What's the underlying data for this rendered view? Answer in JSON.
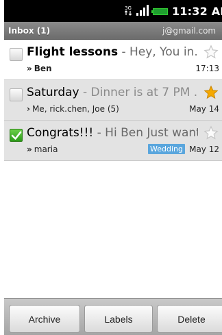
{
  "status_bar": {
    "network_icon": "3g-data-icon",
    "signal_icon": "signal-bars-icon",
    "battery_icon": "battery-icon",
    "time": "11:32 AM"
  },
  "header": {
    "title": "Inbox (1)",
    "account": "j@gmail.com"
  },
  "messages": [
    {
      "subject": "Flight lessons",
      "snippet": " - Hey, You in...",
      "senders": "Ben",
      "sender_prefix": "»",
      "time": "17:13",
      "unread": true,
      "checked": false,
      "starred": false,
      "label": null
    },
    {
      "subject": "Saturday",
      "snippet": " - Dinner is at 7 PM ...",
      "senders": "Me, rick.chen, Joe (5)",
      "sender_prefix": "›",
      "time": "May 14",
      "unread": false,
      "checked": false,
      "starred": true,
      "label": null
    },
    {
      "subject": "Congrats!!!",
      "snippet": " - Hi Ben Just want...",
      "senders": "maria",
      "sender_prefix": "»",
      "time": "May 12",
      "unread": false,
      "checked": true,
      "starred": false,
      "label": "Wedding"
    }
  ],
  "actions": {
    "archive": "Archive",
    "labels": "Labels",
    "delete": "Delete"
  },
  "colors": {
    "checkbox_checked": "#2b9a19",
    "star_on": "#f5a800",
    "label_tag": "#5aa6dd",
    "read_row": "#e3e3e3"
  }
}
